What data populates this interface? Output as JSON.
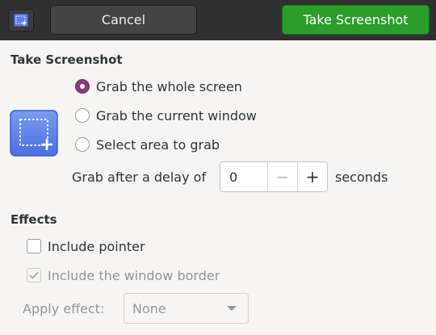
{
  "header": {
    "cancel_label": "Cancel",
    "take_label": "Take Screenshot",
    "app_icon": "screenshot-icon"
  },
  "capture": {
    "title": "Take Screenshot",
    "options": [
      {
        "label": "Grab the whole screen",
        "checked": true
      },
      {
        "label": "Grab the current window",
        "checked": false
      },
      {
        "label": "Select area to grab",
        "checked": false
      }
    ],
    "delay_label": "Grab after a delay of",
    "delay_value": "0",
    "seconds_label": "seconds"
  },
  "effects": {
    "title": "Effects",
    "include_pointer": {
      "label": "Include pointer",
      "checked": false
    },
    "include_border": {
      "label": "Include the window border",
      "checked": true,
      "disabled": true
    },
    "apply_effect_label": "Apply effect:",
    "apply_effect_value": "None"
  },
  "colors": {
    "accent_radio": "#893a7d",
    "take_button": "#2b9d2b",
    "headerbar": "#303030"
  }
}
